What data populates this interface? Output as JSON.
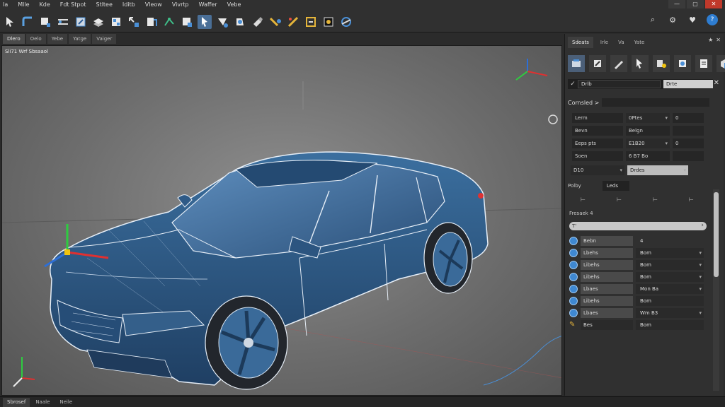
{
  "menu": [
    "Ia",
    "Mlle",
    "Kde",
    "Fdt Stpot",
    "Stltee",
    "Iditb",
    "Vleow",
    "Vivrtp",
    "Waffer",
    "Vebe"
  ],
  "toolbar_icons": [
    "select-arrow-icon",
    "bend-tool-icon",
    "box-select-icon",
    "shear-icon",
    "transform-icon",
    "cube-icon",
    "move-icon",
    "scale-icon",
    "layers-icon",
    "grid-snap-icon",
    "vertex-connect-icon",
    "box-icon",
    "select-object-icon",
    "lasso-icon",
    "paint-icon",
    "brush-icon",
    "bevel-icon",
    "knife-icon",
    "measure-icon",
    "camera-icon",
    "orbit-icon"
  ],
  "top_right": {
    "search": "search-icon",
    "settings": "gear-icon",
    "favorite": "heart-icon",
    "help": "help-icon"
  },
  "viewport_tabs": [
    "Dlero",
    "Oelo",
    "Yebe",
    "Yatge",
    "Vaiger"
  ],
  "viewport": {
    "label": "Sli71 Wrf Sbsaaol"
  },
  "panel": {
    "tabs": [
      "Sdeats",
      "Irle",
      "Va",
      "Yate"
    ],
    "name_field": "Drlb",
    "name_select": "Drte",
    "section_title": "Cornsled >",
    "grid_rows": [
      [
        "Lerm",
        "0Ptes",
        "0"
      ],
      [
        "Bevn",
        "Belgn",
        ""
      ],
      [
        "Eeps pts",
        "E1B20",
        "0"
      ],
      [
        "Soen",
        "6 B7 Bo",
        ""
      ]
    ],
    "dd_row": [
      "D10",
      "Drdes"
    ],
    "poly_label": "Polby",
    "poly_value": "Leds",
    "freeze_label": "Fresaek 4",
    "slider_value": "T'",
    "properties": [
      {
        "label": "Bebn",
        "value": "4"
      },
      {
        "label": "Lbehs",
        "value": "Bom"
      },
      {
        "label": "Libehs",
        "value": "Bom"
      },
      {
        "label": "Libehs",
        "value": "Bom"
      },
      {
        "label": "Lbaes",
        "value": "Mon  Ba"
      },
      {
        "label": "Libehs",
        "value": "Bom"
      },
      {
        "label": "Lbaes",
        "value": "Wm  B3"
      },
      {
        "label": "Bes",
        "value": "Bom"
      }
    ]
  },
  "bottom_tabs": [
    "Sbrosef",
    "Naale",
    "Neile"
  ],
  "colors": {
    "accent": "#4a6f97",
    "car_body": "#2f5d8a",
    "viewport": "#7a7a7a",
    "panel": "#303030"
  }
}
